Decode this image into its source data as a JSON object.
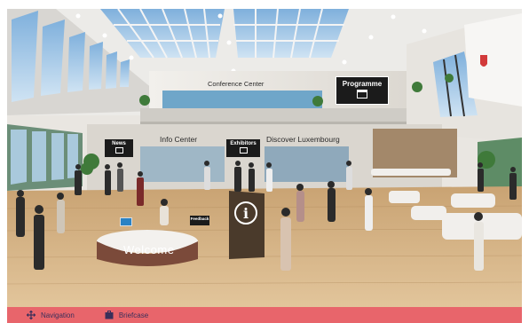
{
  "scene": {
    "signs": {
      "conference": "Conference Center",
      "programme": "Programme",
      "news": "News",
      "info_center": "Info Center",
      "exhibitors": "Exhibitors",
      "discover": "Discover Luxembourg",
      "feedback": "Feedback",
      "welcome": "Welcome"
    }
  },
  "bottom_bar": {
    "navigation_label": "Navigation",
    "briefcase_label": "Briefcase"
  },
  "colors": {
    "accent_bar": "#e8656b",
    "bar_text": "#3a2f5a",
    "sign_bg": "#1b1b1b"
  }
}
